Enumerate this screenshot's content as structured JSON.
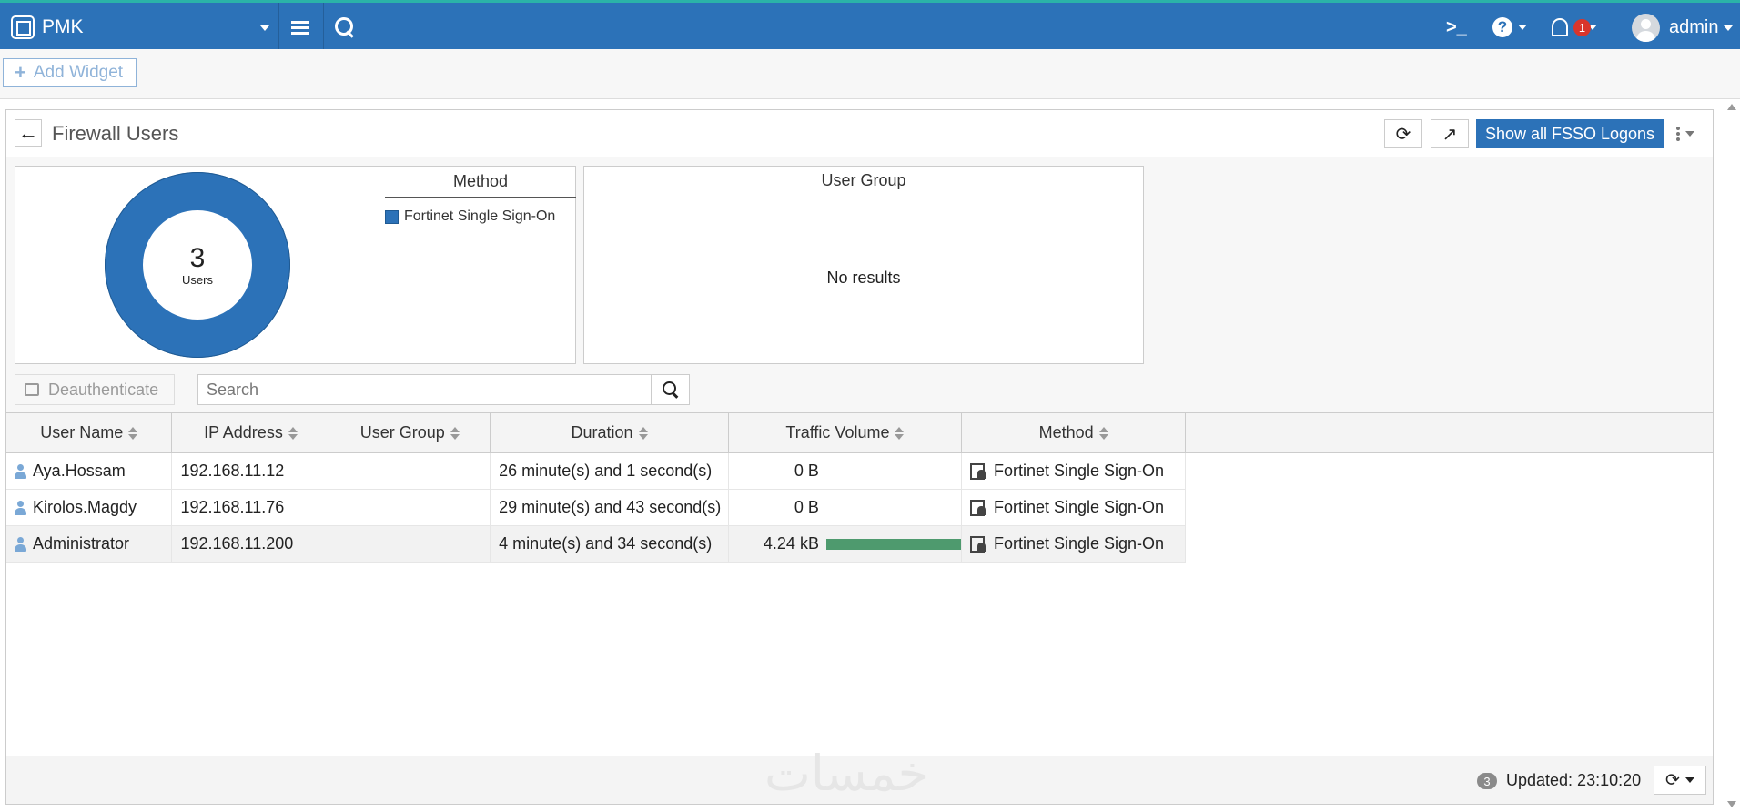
{
  "app": {
    "title": "PMK"
  },
  "topbar": {
    "notification_count": "1",
    "user": "admin",
    "cli_icon": "terminal-icon",
    "help_icon": "help-icon",
    "bell_icon": "bell-icon"
  },
  "widgetbar": {
    "add_widget_label": "Add Widget"
  },
  "panel": {
    "title": "Firewall Users",
    "show_fsso_label": "Show all FSSO Logons"
  },
  "summary": {
    "donut": {
      "count": "3",
      "label": "Users",
      "color": "#2c72b8"
    },
    "legend": {
      "title": "Method",
      "items": [
        {
          "label": "Fortinet Single Sign-On",
          "color": "#2c72b8"
        }
      ]
    },
    "user_group": {
      "title": "User Group",
      "empty_text": "No results"
    }
  },
  "toolbar": {
    "deauth_label": "Deauthenticate",
    "search_placeholder": "Search"
  },
  "table": {
    "columns": [
      "User Name",
      "IP Address",
      "User Group",
      "Duration",
      "Traffic Volume",
      "Method"
    ],
    "rows": [
      {
        "user": "Aya.Hossam",
        "ip": "192.168.11.12",
        "group": "",
        "duration": "26 minute(s) and 1 second(s)",
        "traffic": "0 B",
        "traffic_fraction": 0,
        "method": "Fortinet Single Sign-On"
      },
      {
        "user": "Kirolos.Magdy",
        "ip": "192.168.11.76",
        "group": "",
        "duration": "29 minute(s) and 43 second(s)",
        "traffic": "0 B",
        "traffic_fraction": 0,
        "method": "Fortinet Single Sign-On"
      },
      {
        "user": "Administrator",
        "ip": "192.168.11.200",
        "group": "",
        "duration": "4 minute(s) and 34 second(s)",
        "traffic": "4.24 kB",
        "traffic_fraction": 1,
        "method": "Fortinet Single Sign-On"
      }
    ],
    "selected_row": 2
  },
  "footer": {
    "count": "3",
    "updated": "Updated: 23:10:20"
  },
  "watermark": "خمسات",
  "colors": {
    "brand": "#2c72b8",
    "topbar_accent": "#2bb3a8",
    "traffic_bar": "#4e9a6e",
    "badge": "#d9352b"
  }
}
